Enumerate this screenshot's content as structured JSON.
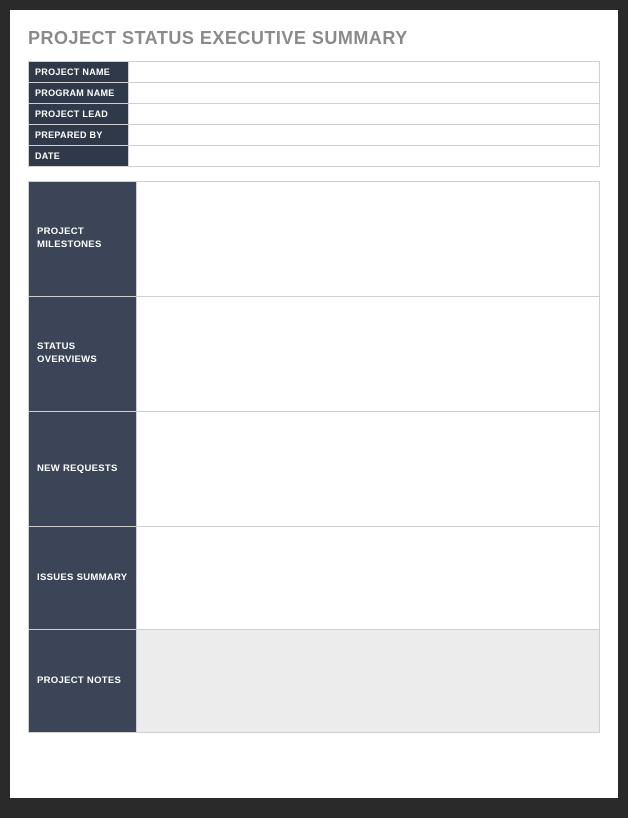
{
  "title": "PROJECT STATUS EXECUTIVE SUMMARY",
  "info": [
    {
      "label": "PROJECT NAME",
      "value": ""
    },
    {
      "label": "PROGRAM NAME",
      "value": ""
    },
    {
      "label": "PROJECT LEAD",
      "value": ""
    },
    {
      "label": "PREPARED BY",
      "value": ""
    },
    {
      "label": "DATE",
      "value": ""
    }
  ],
  "sections": [
    {
      "label": "PROJECT\nMILESTONES",
      "value": ""
    },
    {
      "label": "STATUS\nOVERVIEWS",
      "value": ""
    },
    {
      "label": "NEW REQUESTS",
      "value": ""
    },
    {
      "label": "ISSUES SUMMARY",
      "value": ""
    },
    {
      "label": "PROJECT NOTES",
      "value": ""
    }
  ]
}
